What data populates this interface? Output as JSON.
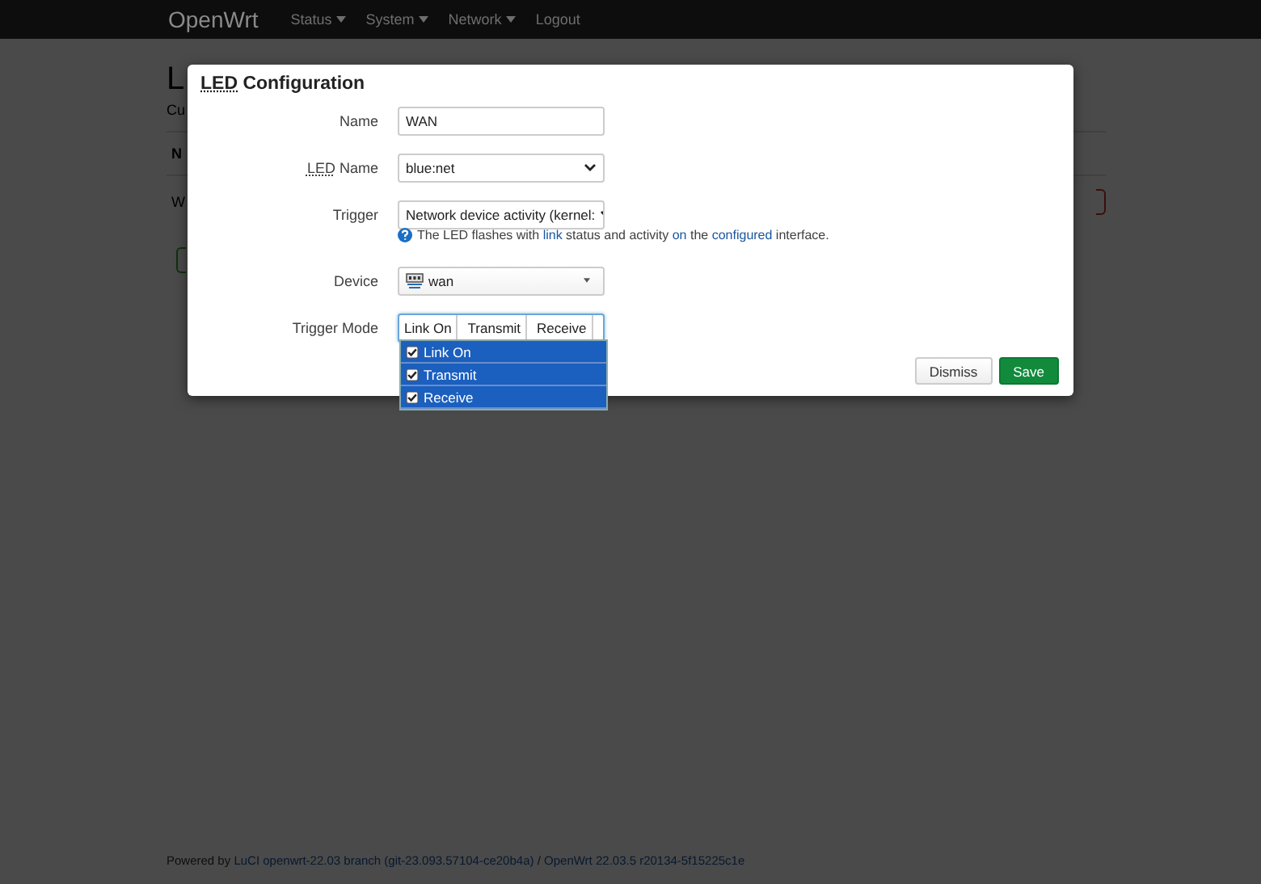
{
  "navbar": {
    "brand": "OpenWrt",
    "menu": [
      {
        "label": "Status",
        "dropdown": true
      },
      {
        "label": "System",
        "dropdown": true
      },
      {
        "label": "Network",
        "dropdown": true
      },
      {
        "label": "Logout",
        "dropdown": false
      }
    ]
  },
  "background_page": {
    "heading": "L",
    "description": "Cu",
    "table_header": "N",
    "table_row": "W"
  },
  "dialog": {
    "title_abbr": "LED",
    "title": "Configuration",
    "fields": [
      {
        "kind": "text",
        "label": "Name",
        "value": "WAN"
      },
      {
        "kind": "select",
        "label_abbr": "LED",
        "label": "Name",
        "value": "blue:net"
      },
      {
        "kind": "select",
        "label": "Trigger",
        "value": "Network device activity (kernel:",
        "help": [
          {
            "text": "The LED flashes with ",
            "link": false
          },
          {
            "text": "link",
            "link": true
          },
          {
            "text": " status and activity ",
            "link": false
          },
          {
            "text": "on",
            "link": true
          },
          {
            "text": " the ",
            "link": false
          },
          {
            "text": "configured",
            "link": true
          },
          {
            "text": " interface.",
            "link": false
          }
        ]
      },
      {
        "kind": "device",
        "label": "Device",
        "value": "wan"
      },
      {
        "kind": "multi",
        "label": "Trigger Mode",
        "chips": [
          "Link On",
          "Transmit",
          "Receive"
        ],
        "expanded": true,
        "options": [
          {
            "label": "Link On",
            "checked": true,
            "selected": true
          },
          {
            "label": "Transmit",
            "checked": true,
            "selected": true
          },
          {
            "label": "Receive",
            "checked": true,
            "selected": true
          }
        ]
      }
    ],
    "buttons": [
      {
        "kind": "neutral",
        "label": "Dismiss"
      },
      {
        "kind": "save",
        "label": "Save"
      }
    ]
  },
  "footer": [
    {
      "text": "Powered by ",
      "link": false
    },
    {
      "text": "LuCI openwrt-22.03 branch (git-23.093.57104-ce20b4a)",
      "link": true
    },
    {
      "text": " / ",
      "link": false
    },
    {
      "text": "OpenWrt 22.03.5 r20134-5f15225c1e",
      "link": true
    }
  ]
}
